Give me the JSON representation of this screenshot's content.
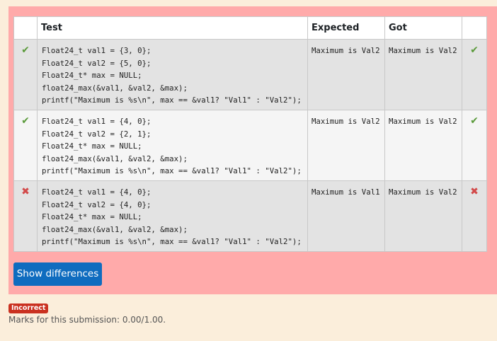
{
  "table": {
    "headers": {
      "test": "Test",
      "expected": "Expected",
      "got": "Got"
    },
    "rows": [
      {
        "status": "pass",
        "status_icon": "✔",
        "test_code": "Float24_t val1 = {3, 0};\nFloat24_t val2 = {5, 0};\nFloat24_t* max = NULL;\nfloat24_max(&val1, &val2, &max);\nprintf(\"Maximum is %s\\n\", max == &val1? \"Val1\" : \"Val2\");",
        "expected": "Maximum is Val2",
        "got": "Maximum is Val2",
        "result_icon": "✔"
      },
      {
        "status": "pass",
        "status_icon": "✔",
        "test_code": "Float24_t val1 = {4, 0};\nFloat24_t val2 = {2, 1};\nFloat24_t* max = NULL;\nfloat24_max(&val1, &val2, &max);\nprintf(\"Maximum is %s\\n\", max == &val1? \"Val1\" : \"Val2\");",
        "expected": "Maximum is Val2",
        "got": "Maximum is Val2",
        "result_icon": "✔"
      },
      {
        "status": "fail",
        "status_icon": "✖",
        "test_code": "Float24_t val1 = {4, 0};\nFloat24_t val2 = {4, 0};\nFloat24_t* max = NULL;\nfloat24_max(&val1, &val2, &max);\nprintf(\"Maximum is %s\\n\", max == &val1? \"Val1\" : \"Val2\");",
        "expected": "Maximum is Val1",
        "got": "Maximum is Val2",
        "result_icon": "✖"
      }
    ]
  },
  "show_differences_label": "Show differences",
  "result_badge": "Incorrect",
  "marks_text": "Marks for this submission: 0.00/1.00.",
  "colors": {
    "panel_bg": "#ffaaaa",
    "page_bg": "#fbeedb",
    "pass": "#5a9a3a",
    "fail": "#d24a4a",
    "button": "#0f6cbf",
    "badge": "#ca3120"
  }
}
